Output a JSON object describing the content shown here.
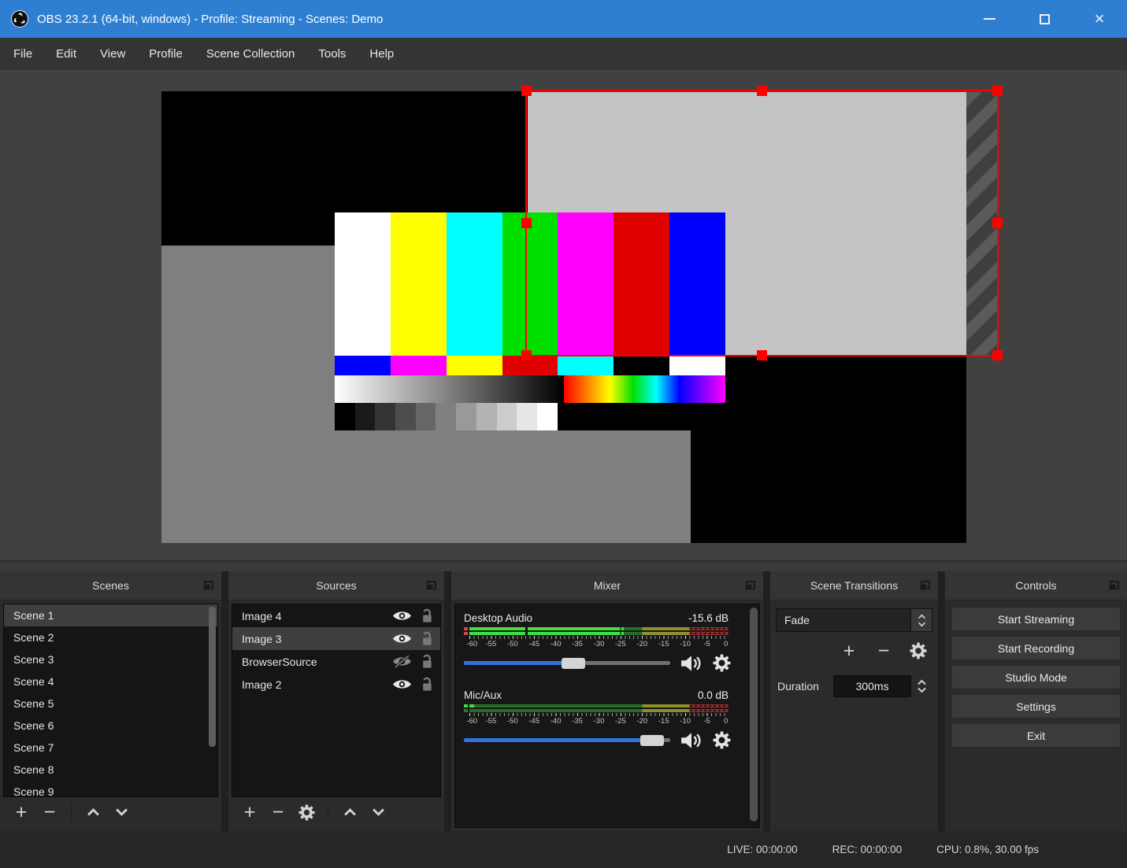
{
  "colors": {
    "titlebar": "#2e7fd2",
    "selection_red": "#ff0000",
    "meter_green_active": "#3fe03f",
    "meter_yellow": "#8f8f2d",
    "meter_red": "#8f2d2d",
    "slider_blue": "#3173d9"
  },
  "icons": {
    "app_logo": "obs-shutter-swirl",
    "minimize": "horizontal-line",
    "maximize": "square-outline",
    "close": "x-cross",
    "panel_float": "overlapping-squares",
    "visible": "eye",
    "hidden": "eye-slash",
    "unlocked": "open-padlock",
    "add": "plus",
    "remove": "minus",
    "properties": "gear",
    "move_up": "chevron-up",
    "move_down": "chevron-down",
    "volume": "speaker-waves"
  },
  "window": {
    "title": "OBS 23.2.1 (64-bit, windows) - Profile: Streaming - Scenes: Demo",
    "close_glyph": "×"
  },
  "menu": {
    "items": [
      "File",
      "Edit",
      "View",
      "Profile",
      "Scene Collection",
      "Tools",
      "Help"
    ]
  },
  "scenes": {
    "title": "Scenes",
    "selected": "Scene 1",
    "items": [
      "Scene 1",
      "Scene 2",
      "Scene 3",
      "Scene 4",
      "Scene 5",
      "Scene 6",
      "Scene 7",
      "Scene 8",
      "Scene 9"
    ]
  },
  "sources": {
    "title": "Sources",
    "selected": "Image 3",
    "items": [
      {
        "name": "Image 4",
        "visible": true,
        "locked": false
      },
      {
        "name": "Image 3",
        "visible": true,
        "locked": false
      },
      {
        "name": "BrowserSource",
        "visible": false,
        "locked": false
      },
      {
        "name": "Image 2",
        "visible": true,
        "locked": false
      }
    ]
  },
  "mixer": {
    "title": "Mixer",
    "ticks": [
      "-60",
      "-55",
      "-50",
      "-45",
      "-40",
      "-35",
      "-30",
      "-25",
      "-20",
      "-15",
      "-10",
      "-5",
      "0"
    ],
    "channels": [
      {
        "name": "Desktop Audio",
        "level": "-15.6 dB"
      },
      {
        "name": "Mic/Aux",
        "level": "0.0 dB"
      }
    ]
  },
  "transitions": {
    "title": "Scene Transitions",
    "selected": "Fade",
    "duration_label": "Duration",
    "duration_value": "300ms"
  },
  "controls": {
    "title": "Controls",
    "buttons": [
      "Start Streaming",
      "Start Recording",
      "Studio Mode",
      "Settings",
      "Exit"
    ]
  },
  "statusbar": {
    "live": "LIVE: 00:00:00",
    "rec": "REC: 00:00:00",
    "cpu": "CPU: 0.8%, 30.00 fps"
  }
}
